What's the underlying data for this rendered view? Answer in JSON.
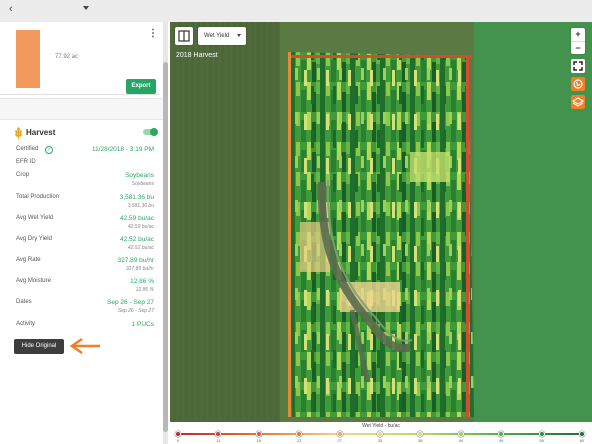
{
  "topbar": {
    "back_glyph": "‹",
    "dropdown": ""
  },
  "field": {
    "acres": "77.92 ac",
    "menu_glyph": "⋮",
    "export_label": "Export"
  },
  "harvest": {
    "title": "Harvest",
    "rows": {
      "certified": {
        "label": "Certified",
        "value": "11/28/2018 - 3:19 PM"
      },
      "efr": {
        "label": "EFR ID"
      },
      "crop": {
        "label": "Crop",
        "value": "Soybeans",
        "sub": "Soybeans"
      },
      "total_production": {
        "label": "Total Production",
        "value": "3,581.36 bu",
        "sub": "3,581.36 bu"
      },
      "avg_wet_yield": {
        "label": "Avg Wet Yield",
        "value": "42.59 bu/ac",
        "sub": "42.59 bu/ac"
      },
      "avg_dry_yield": {
        "label": "Avg Dry Yield",
        "value": "42.52 bu/ac",
        "sub": "42.52 bu/ac"
      },
      "avg_rate": {
        "label": "Avg Rate",
        "value": "327.89 bu/hr",
        "sub": "327.89 bu/hr"
      },
      "avg_moisture": {
        "label": "Avg Moisture",
        "value": "12.86 %",
        "sub": "12.86 %"
      },
      "dates": {
        "label": "Dates",
        "value": "Sep 26 - Sep 27",
        "sub": "Sep 26 - Sep 27"
      },
      "activity": {
        "label": "Activity",
        "value": "1 PUCs"
      }
    },
    "hide_original_label": "Hide Original"
  },
  "map": {
    "layer_select": "Wet Yield",
    "season_label": "2018 Harvest",
    "zoom_in": "+",
    "zoom_out": "−"
  },
  "legend": {
    "title": "Wet Yield - bu/ac",
    "ticks": [
      "0",
      "11",
      "16",
      "22",
      "27",
      "33",
      "38",
      "44",
      "49",
      "55",
      "60"
    ],
    "colors": [
      "#c0282a",
      "#d1402d",
      "#e05a30",
      "#e8762e",
      "#f0a35a",
      "#f3d58a",
      "#cfe08a",
      "#9fd06a",
      "#4fae4a",
      "#2f8f3f",
      "#1d6f37"
    ]
  },
  "colors": {
    "accent_green": "#2aa862",
    "accent_orange": "#f07f25"
  }
}
